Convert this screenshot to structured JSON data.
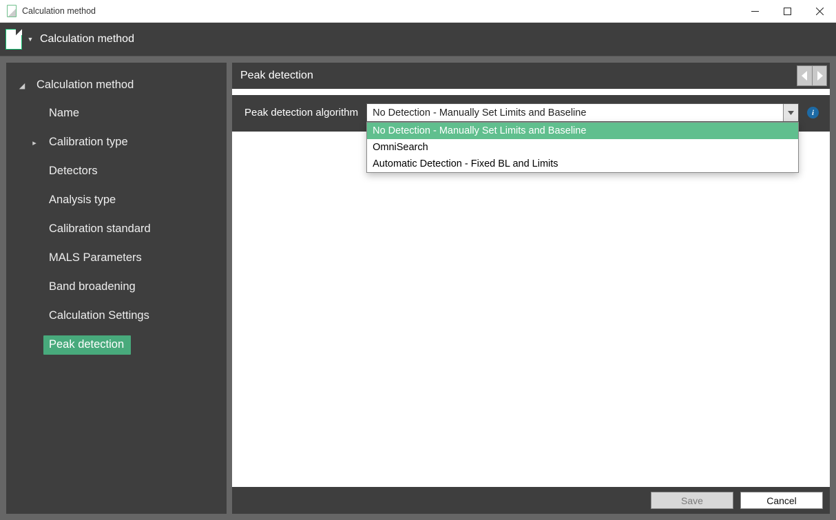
{
  "window": {
    "title": "Calculation method",
    "ribbon_title": "Calculation method"
  },
  "sidebar": {
    "root": "Calculation method",
    "items": [
      {
        "label": "Name",
        "hasChildren": false
      },
      {
        "label": "Calibration type",
        "hasChildren": true
      },
      {
        "label": "Detectors",
        "hasChildren": false
      },
      {
        "label": "Analysis type",
        "hasChildren": false
      },
      {
        "label": "Calibration standard",
        "hasChildren": false
      },
      {
        "label": "MALS Parameters",
        "hasChildren": false
      },
      {
        "label": "Band broadening",
        "hasChildren": false
      },
      {
        "label": "Calculation Settings",
        "hasChildren": false
      },
      {
        "label": "Peak detection",
        "hasChildren": false,
        "selected": true
      }
    ]
  },
  "main": {
    "title": "Peak detection",
    "form": {
      "label": "Peak detection algorithm",
      "value": "No Detection - Manually Set Limits and Baseline",
      "options": [
        "No Detection - Manually Set Limits and Baseline",
        "OmniSearch",
        "Automatic Detection - Fixed BL and Limits"
      ]
    }
  },
  "footer": {
    "save": "Save",
    "cancel": "Cancel"
  }
}
